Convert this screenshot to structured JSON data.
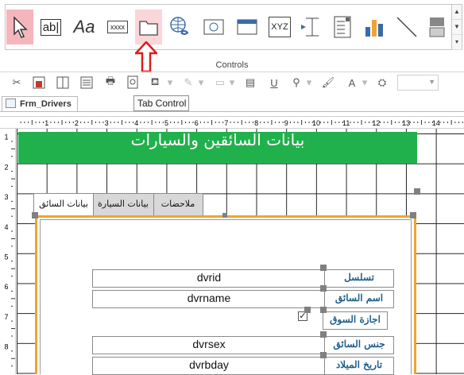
{
  "ribbon": {
    "group_label": "Controls",
    "text_box_glyph": "ab|",
    "label_glyph": "Aa",
    "button_glyph": "xxxx",
    "option_group_glyph": "XYZ"
  },
  "tooltip": {
    "text": "Tab Control"
  },
  "document_tab": {
    "title": "Frm_Drivers"
  },
  "ruler": {
    "marks": [
      "1",
      "2",
      "3",
      "4",
      "5",
      "6",
      "7",
      "8",
      "9",
      "10",
      "11",
      "12",
      "13",
      "14"
    ]
  },
  "vruler": {
    "marks": [
      "1",
      "2",
      "3",
      "4",
      "5",
      "6",
      "7",
      "8"
    ]
  },
  "form": {
    "title": "بيانات السائقين والسيارات",
    "tabs": [
      {
        "label": "بيانات السائق"
      },
      {
        "label": "بيانات السيارة"
      },
      {
        "label": "ملاحضات"
      }
    ],
    "fields": [
      {
        "label": "تسلسل",
        "value": "dvrid"
      },
      {
        "label": "اسم السائق",
        "value": "dvrname"
      },
      {
        "label": "اجازة السوق",
        "value": ""
      },
      {
        "label": "جنس السائق",
        "value": "dvrsex"
      },
      {
        "label": "تاريخ الميلاد",
        "value": "dvrbday"
      }
    ],
    "checkbox_mark": "✓"
  },
  "colors": {
    "title_band": "#21b14c",
    "tab_border": "#f0a430",
    "label_text": "#1f5f8b"
  }
}
